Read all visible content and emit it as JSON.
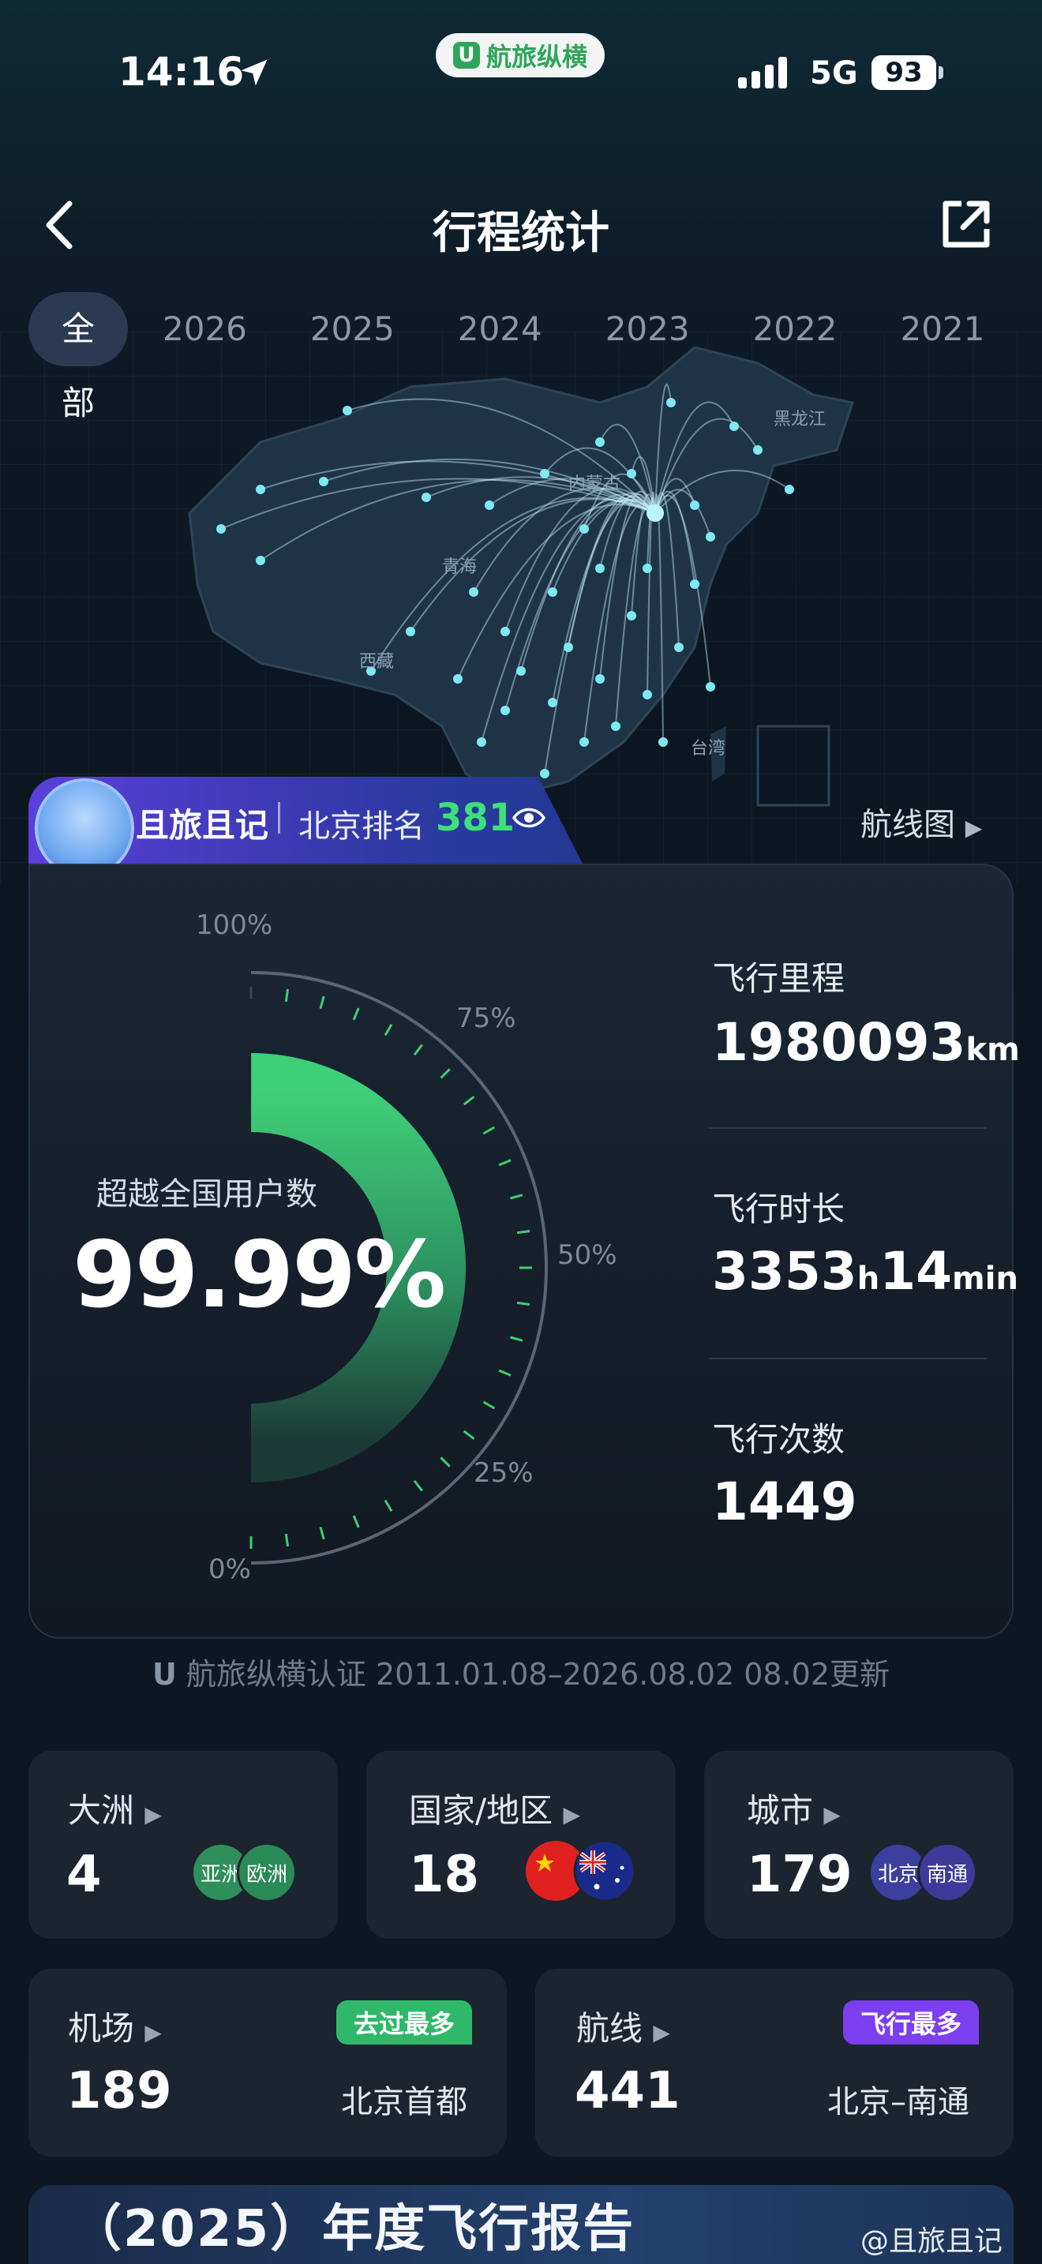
{
  "status_bar": {
    "time": "14:16",
    "app_badge": "航旅纵横",
    "network": "5G",
    "battery": "93"
  },
  "nav": {
    "title": "行程统计"
  },
  "tabs": [
    {
      "label": "全部",
      "active": true
    },
    {
      "label": "2026"
    },
    {
      "label": "2025"
    },
    {
      "label": "2024"
    },
    {
      "label": "2023"
    },
    {
      "label": "2022"
    },
    {
      "label": "2021"
    }
  ],
  "map": {
    "labels": [
      "内蒙古",
      "黑龙江",
      "青海",
      "西藏",
      "台湾"
    ]
  },
  "user": {
    "name": "且旅且记",
    "rank_label": "北京排名",
    "rank": "381",
    "routes_link": "航线图"
  },
  "gauge": {
    "label": "超越全国用户数",
    "value_text": "99.99%",
    "fraction": 0.9999,
    "ticks": [
      "100%",
      "75%",
      "50%",
      "25%",
      "0%"
    ]
  },
  "stats": [
    {
      "label": "飞行里程",
      "value": "1980093",
      "unit": "km"
    },
    {
      "label": "飞行时长",
      "value1": "3353",
      "unit1": "h",
      "value2": "14",
      "unit2": "min"
    },
    {
      "label": "飞行次数",
      "value": "1449"
    }
  ],
  "verify_text": "航旅纵横认证 2011.01.08–2026.08.02 08.02更新",
  "summary": {
    "continents": {
      "label": "大洲",
      "value": "4",
      "chips": [
        "亚洲",
        "欧洲"
      ]
    },
    "countries": {
      "label": "国家/地区",
      "value": "18"
    },
    "cities": {
      "label": "城市",
      "value": "179",
      "chips": [
        "北京",
        "南通"
      ]
    },
    "airports": {
      "label": "机场",
      "value": "189",
      "tag": "去过最多",
      "sub": "北京首都"
    },
    "routes": {
      "label": "航线",
      "value": "441",
      "tag": "飞行最多",
      "sub": "北京–南通"
    }
  },
  "report_banner": "（2025）年度飞行报告",
  "watermark": "@且旅且记",
  "colors": {
    "accent_green": "#3ee07a",
    "banner_purple": "#5b3fd9",
    "tag_green": "#2fb86a",
    "tag_purple": "#7b3ff0"
  }
}
